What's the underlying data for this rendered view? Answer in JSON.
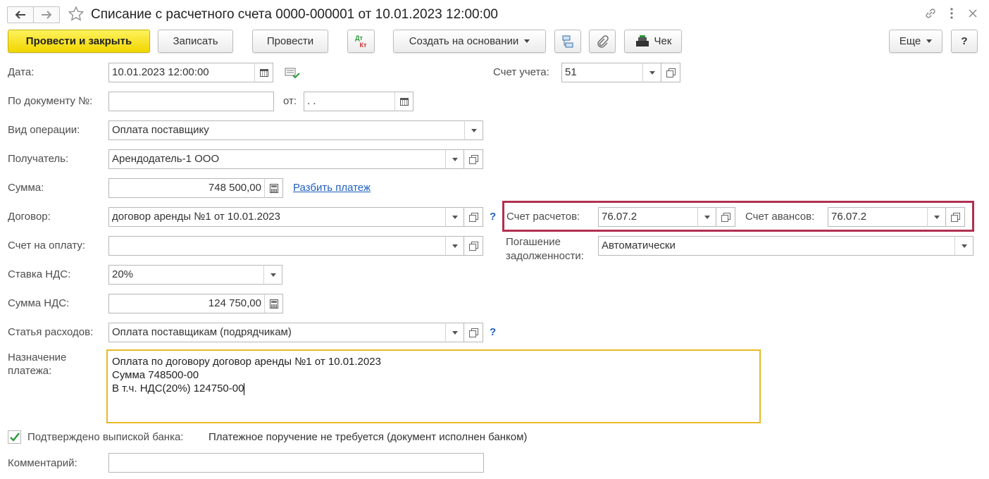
{
  "window": {
    "title": "Списание с расчетного счета 0000-000001 от 10.01.2023 12:00:00"
  },
  "toolbar": {
    "post_close": "Провести и закрыть",
    "write": "Записать",
    "post": "Провести",
    "dtkt_top": "Дт",
    "dtkt_bottom": "Кт",
    "create_based": "Создать на основании",
    "check": "Чек",
    "more": "Еще",
    "help": "?"
  },
  "form": {
    "date_label": "Дата:",
    "date_value": "10.01.2023 12:00:00",
    "account_label": "Счет учета:",
    "account_value": "51",
    "docnum_label": "По документу №:",
    "docnum_value": "",
    "from_label": "от:",
    "from_value": " .  .",
    "op_label": "Вид операции:",
    "op_value": "Оплата поставщику",
    "recipient_label": "Получатель:",
    "recipient_value": "Арендодатель-1 ООО",
    "sum_label": "Сумма:",
    "sum_value": "748 500,00",
    "split_link": "Разбить платеж",
    "contract_label": "Договор:",
    "contract_value": "договор аренды №1 от 10.01.2023",
    "settle_label": "Счет расчетов:",
    "settle_value": "76.07.2",
    "advance_label": "Счет авансов:",
    "advance_value": "76.07.2",
    "invoice_label": "Счет на оплату:",
    "invoice_value": "",
    "repay_label_1": "Погашение",
    "repay_label_2": "задолженности:",
    "repay_value": "Автоматически",
    "vat_rate_label": "Ставка НДС:",
    "vat_rate_value": "20%",
    "vat_sum_label": "Сумма НДС:",
    "vat_sum_value": "124 750,00",
    "expense_label": "Статья расходов:",
    "expense_value": "Оплата поставщикам (подрядчикам)",
    "purpose_label_1": "Назначение",
    "purpose_label_2": "платежа:",
    "purpose_line_1": "Оплата по договору договор аренды №1 от 10.01.2023",
    "purpose_line_2": "Сумма 748500-00",
    "purpose_line_3": "В т.ч. НДС(20%) 124750-00",
    "confirmed_label": "Подтверждено выпиской банка:",
    "confirmed_note": "Платежное поручение не требуется (документ исполнен банком)",
    "comment_label": "Комментарий:",
    "comment_value": "",
    "help_q": "?"
  },
  "colors": {
    "primary": "#f5de1a",
    "highlight_frame": "#b03050",
    "active_border": "#e8b923",
    "link": "#1f5fbf",
    "check": "#2a9a3a"
  }
}
